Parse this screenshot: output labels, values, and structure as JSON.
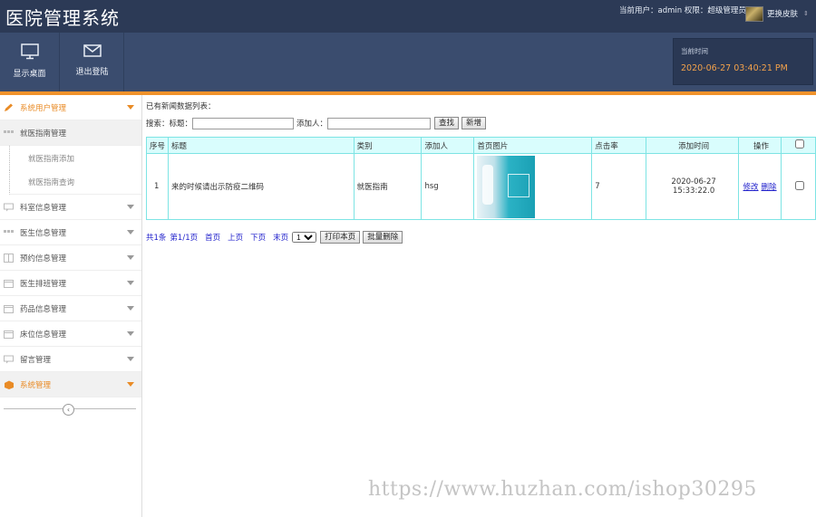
{
  "header": {
    "title": "医院管理系统",
    "user_info": "当前用户：admin  权限：超级管理员",
    "skin_label": "更换皮肤"
  },
  "toolbar": {
    "items": [
      {
        "label": "显示桌面",
        "icon": "monitor-icon"
      },
      {
        "label": "退出登陆",
        "icon": "mail-icon"
      }
    ],
    "time_label": "当前时间",
    "time_value": "2020-06-27 03:40:21 PM"
  },
  "sidebar": {
    "items": [
      {
        "label": "系统用户管理",
        "icon": "pencil-icon"
      },
      {
        "label": "就医指南管理",
        "icon": "grid-icon"
      },
      {
        "label": "科室信息管理",
        "icon": "chat-icon"
      },
      {
        "label": "医生信息管理",
        "icon": "grid-icon"
      },
      {
        "label": "预约信息管理",
        "icon": "book-icon"
      },
      {
        "label": "医生排班管理",
        "icon": "calendar-icon"
      },
      {
        "label": "药品信息管理",
        "icon": "calendar-icon"
      },
      {
        "label": "床位信息管理",
        "icon": "calendar-icon"
      },
      {
        "label": "留言管理",
        "icon": "chat-icon"
      },
      {
        "label": "系统管理",
        "icon": "box-icon"
      }
    ],
    "sub_items": [
      "就医指南添加",
      "就医指南查询"
    ]
  },
  "main": {
    "caption": "已有新闻数据列表：",
    "search_label": "搜索：标题：",
    "adder_label": "添加人：",
    "search_button": "查找",
    "new_button": "新增",
    "columns": [
      "序号",
      "标题",
      "类别",
      "添加人",
      "首页图片",
      "点击率",
      "添加时间",
      "操作"
    ],
    "rows": [
      {
        "index": "1",
        "title": "来的时候请出示防疫二维码",
        "category": "就医指南",
        "adder": "hsg",
        "clicks": "7",
        "time": "2020-06-27 15:33:22.0",
        "edit": "修改",
        "delete": "删除"
      }
    ],
    "pager": {
      "total": "共1条",
      "page": "第1/1页",
      "first": "首页",
      "prev": "上页",
      "next": "下页",
      "last": "末页",
      "select_value": "1",
      "print_button": "打印本页",
      "batch_delete_button": "批量删除"
    }
  },
  "watermark": "https://www.huzhan.com/ishop30295",
  "colors": {
    "header": "#2c3a56",
    "toolbar": "#3a4c6e",
    "accent": "#f0922b",
    "table_border": "#7de4e4",
    "table_header": "#d9fdfd"
  }
}
